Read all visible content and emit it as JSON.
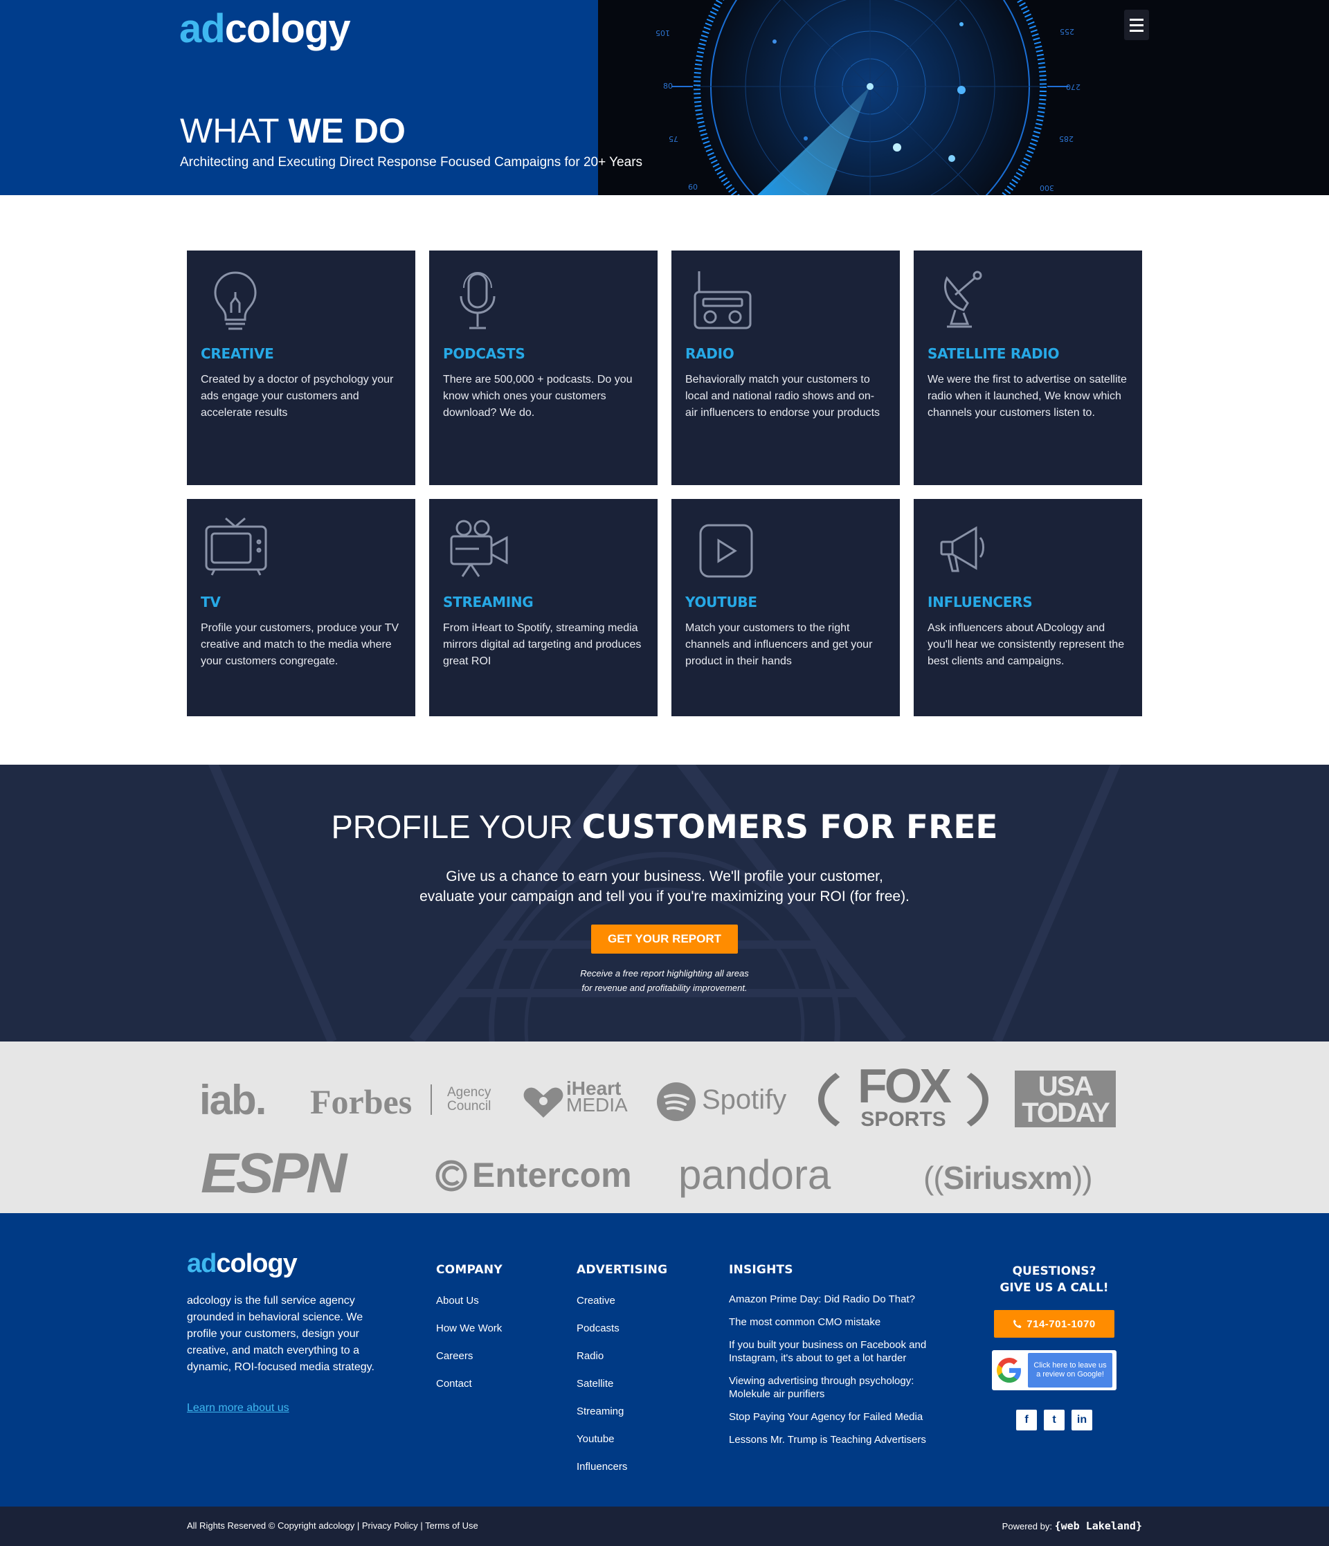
{
  "brand": {
    "logo_ad": "ad",
    "logo_rest": "cology"
  },
  "hero": {
    "title_light": "WHAT",
    "title_bold": "WE DO",
    "subtitle": "Architecting and Executing Direct Response Focused Campaigns for 20+ Years",
    "radar_labels": [
      "105",
      "80",
      "75",
      "60",
      "255",
      "270",
      "285",
      "300"
    ]
  },
  "services": [
    {
      "icon": "lightbulb-icon",
      "title": "CREATIVE",
      "text": "Created by a doctor of psychology your ads engage your customers and accelerate results"
    },
    {
      "icon": "microphone-icon",
      "title": "PODCASTS",
      "text": "There are 500,000 + podcasts. Do you know which ones your customers download? We do."
    },
    {
      "icon": "radio-icon",
      "title": "RADIO",
      "text": "Behaviorally match your customers to local and national radio shows and on-air influencers to endorse your products"
    },
    {
      "icon": "satellite-dish-icon",
      "title": "SATELLITE RADIO",
      "text": "We were the first to advertise on satellite radio when it launched, We know which channels your customers listen to."
    },
    {
      "icon": "tv-icon",
      "title": "TV",
      "text": "Profile your customers, produce your TV creative and match to the media where your customers congregate."
    },
    {
      "icon": "video-camera-icon",
      "title": "STREAMING",
      "text": "From iHeart to Spotify, streaming media mirrors digital ad targeting and produces great ROI"
    },
    {
      "icon": "play-icon",
      "title": "YOUTUBE",
      "text": "Match your customers to the right channels and influencers and get your product in their hands"
    },
    {
      "icon": "megaphone-icon",
      "title": "INFLUENCERS",
      "text": "Ask influencers about ADcology and you'll hear we consistently represent the best clients and campaigns."
    }
  ],
  "profile": {
    "title_light": "PROFILE YOUR",
    "title_bold": "CUSTOMERS FOR FREE",
    "lead_1": "Give us a chance to earn your business. We'll profile your customer,",
    "lead_2": "evaluate your campaign and tell you if you're maximizing your ROI (for free).",
    "cta": "GET YOUR REPORT",
    "note_1": "Receive a free report highlighting all areas",
    "note_2": "for revenue and profitability improvement."
  },
  "partners": {
    "iab": "iab.",
    "forbes": "Forbes",
    "forbes_sub_1": "Agency",
    "forbes_sub_2": "Council",
    "iheart_1": "iHeart",
    "iheart_2": "MEDIA",
    "spotify": "Spotify",
    "fox_1": "FOX",
    "fox_2": "SPORTS",
    "usa_1": "USA",
    "usa_2": "TODAY",
    "espn": "ESPN",
    "entercom": "Entercom",
    "pandora": "pandora",
    "siriusxm": "Siriusxm"
  },
  "footer": {
    "about": "adcology is the full service agency grounded in behavioral science. We profile your customers, design your creative, and match everything to a dynamic, ROI-focused media strategy.",
    "learn_more": "Learn more about us",
    "company": {
      "title": "COMPANY",
      "items": [
        "About Us",
        "How We Work",
        "Careers",
        "Contact"
      ]
    },
    "advertising": {
      "title": "ADVERTISING",
      "items": [
        "Creative",
        "Podcasts",
        "Radio",
        "Satellite",
        "Streaming",
        "Youtube",
        "Influencers"
      ]
    },
    "insights": {
      "title": "INSIGHTS",
      "items": [
        "Amazon Prime Day: Did Radio Do That?",
        "The most common CMO mistake",
        "If you built your business on Facebook and Instagram, it's about to get a lot harder",
        "Viewing advertising through psychology: Molekule air purifiers",
        "Stop Paying Your Agency for Failed Media",
        "Lessons Mr. Trump is Teaching Advertisers"
      ]
    },
    "call_title_1": "QUESTIONS?",
    "call_title_2": "GIVE US A CALL!",
    "phone": "714-701-1070",
    "google_1": "Click here to leave us",
    "google_2": "a review on Google!",
    "social": [
      "f",
      "t",
      "in"
    ]
  },
  "bottom": {
    "copyright": "All Rights Reserved © Copyright adcology  | Privacy Policy | Terms of Use",
    "powered_label": "Powered by:",
    "powered_brand": "{web Lakeland}"
  },
  "colors": {
    "hero_blue": "#003d8c",
    "card_bg": "#1a2238",
    "accent_blue": "#27a9e6",
    "orange": "#ff8c00",
    "footer_blue": "#003a85"
  }
}
